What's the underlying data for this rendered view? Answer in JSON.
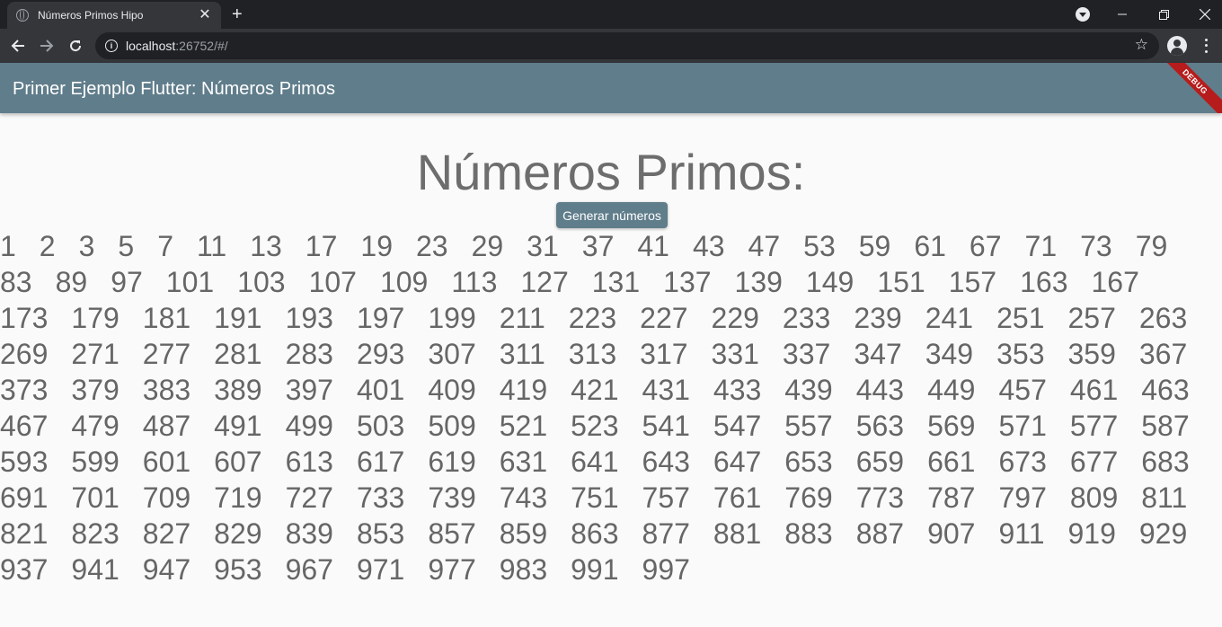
{
  "browser": {
    "tab_title": "Números Primos Hipo",
    "tab_close": "✕",
    "new_tab": "+",
    "url_host": "localhost",
    "url_rest": ":26752/#/"
  },
  "app": {
    "title": "Primer Ejemplo Flutter: Números Primos",
    "debug_banner": "DEBUG",
    "heading": "Números Primos:",
    "button_label": "Generar números",
    "primes": [
      "1",
      "2",
      "3",
      "5",
      "7",
      "11",
      "13",
      "17",
      "19",
      "23",
      "29",
      "31",
      "37",
      "41",
      "43",
      "47",
      "53",
      "59",
      "61",
      "67",
      "71",
      "73",
      "79",
      "83",
      "89",
      "97",
      "101",
      "103",
      "107",
      "109",
      "113",
      "127",
      "131",
      "137",
      "139",
      "149",
      "151",
      "157",
      "163",
      "167",
      "173",
      "179",
      "181",
      "191",
      "193",
      "197",
      "199",
      "211",
      "223",
      "227",
      "229",
      "233",
      "239",
      "241",
      "251",
      "257",
      "263",
      "269",
      "271",
      "277",
      "281",
      "283",
      "293",
      "307",
      "311",
      "313",
      "317",
      "331",
      "337",
      "347",
      "349",
      "353",
      "359",
      "367",
      "373",
      "379",
      "383",
      "389",
      "397",
      "401",
      "409",
      "419",
      "421",
      "431",
      "433",
      "439",
      "443",
      "449",
      "457",
      "461",
      "463",
      "467",
      "479",
      "487",
      "491",
      "499",
      "503",
      "509",
      "521",
      "523",
      "541",
      "547",
      "557",
      "563",
      "569",
      "571",
      "577",
      "587",
      "593",
      "599",
      "601",
      "607",
      "613",
      "617",
      "619",
      "631",
      "641",
      "643",
      "647",
      "653",
      "659",
      "661",
      "673",
      "677",
      "683",
      "691",
      "701",
      "709",
      "719",
      "727",
      "733",
      "739",
      "743",
      "751",
      "757",
      "761",
      "769",
      "773",
      "787",
      "797",
      "809",
      "811",
      "821",
      "823",
      "827",
      "829",
      "839",
      "853",
      "857",
      "859",
      "863",
      "877",
      "881",
      "883",
      "887",
      "907",
      "911",
      "919",
      "929",
      "937",
      "941",
      "947",
      "953",
      "967",
      "971",
      "977",
      "983",
      "991",
      "997"
    ]
  },
  "colors": {
    "appbar": "#607d8b",
    "text": "#666666",
    "debug_banner": "#b71c1c"
  }
}
